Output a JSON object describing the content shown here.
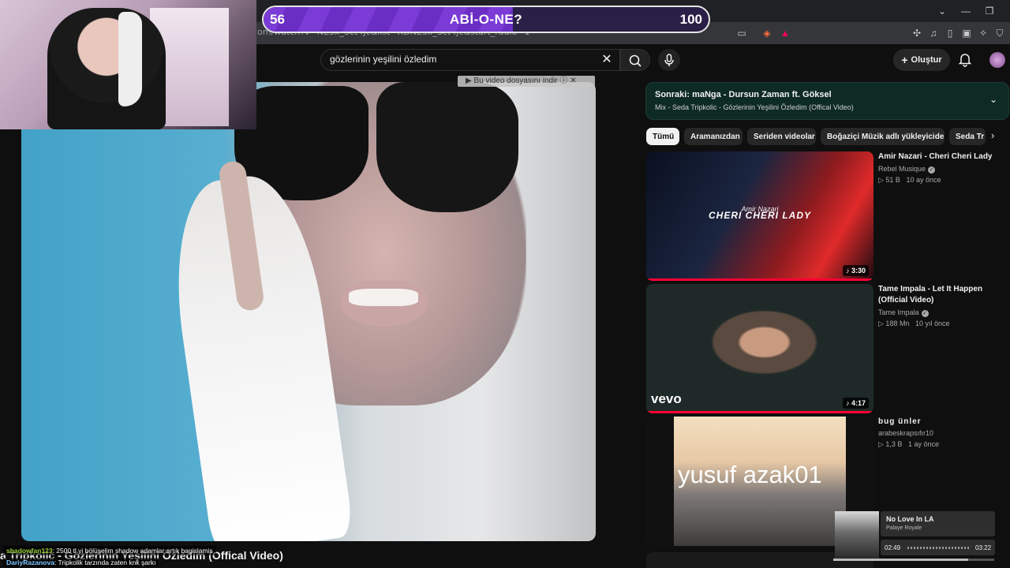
{
  "overlay": {
    "sub_current": "56",
    "sub_goal": "100",
    "sub_title": "ABİ-O-NE?",
    "sub_fraction": 0.56
  },
  "browser": {
    "url": "om/watch?v=NE3x_Sct4Jc&list=RDNE3x_Sct4Jc&start_radio=1"
  },
  "header": {
    "search_value": "gözlerinin yeşilini özledim",
    "create_label": "Oluştur"
  },
  "player": {
    "download_tip": "▶ Bu video dosyasını indir  ⓘ  ✕",
    "title": "a Tripkolic - Gözlerinin Yeşilini Özledim (Offical Video)"
  },
  "chat": [
    {
      "user": "shadowfan123",
      "message": ": 2500 tl yi bölüşelim shadow adamlar artık bagislamis"
    },
    {
      "user": "DariyRazanova",
      "message": ": Tripkolik tarzında zaten knk şarkı"
    }
  ],
  "up_next": {
    "title": "Sonraki: maNga - Dursun Zaman ft. Göksel",
    "subtitle": "Mix - Seda Tripkolic - Gözlerinin Yeşilini Özledim (Offical Video)"
  },
  "chips": [
    "Tümü",
    "Aramanızdan",
    "Seriden videolar",
    "Boğaziçi Müzik adlı yükleyiciden",
    "Seda Tr"
  ],
  "recommendations": [
    {
      "title": "Amir Nazari - Cheri Cheri Lady",
      "channel": "Rebel Musique",
      "views": "51 B",
      "age": "10 ay önce",
      "duration": "3:30",
      "thumb_text": "CHERI CHERI LADY",
      "thumb_top_text": "Amir Nazari"
    },
    {
      "title": "Tame Impala - Let It Happen (Official Video)",
      "channel": "Tame Impala",
      "views": "188 Mn",
      "age": "10 yıl önce",
      "duration": "4:17",
      "thumb_text": "vevo"
    },
    {
      "title": "bug ünler",
      "channel": "arabeskrapsıfır10",
      "views": "1,3 B",
      "age": "1 ay önce",
      "thumb_text": "yusuf azak01"
    }
  ],
  "now_playing": {
    "title": "No Love In LA",
    "artist": "Palaye Royale",
    "elapsed": "02:49",
    "total": "03:22",
    "fraction": 0.84
  },
  "colors": {
    "accent_red": "#ff0033",
    "overlay_purple": "#7b3bd6",
    "up_next_bg": "#0e2a24"
  }
}
